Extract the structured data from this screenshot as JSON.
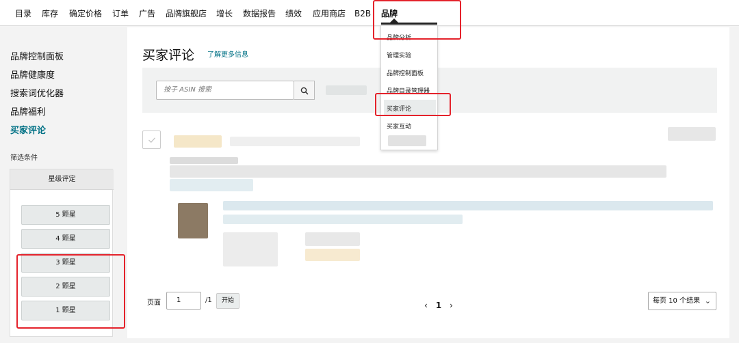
{
  "topnav": {
    "items": [
      "目录",
      "库存",
      "确定价格",
      "订单",
      "广告",
      "品牌旗舰店",
      "增长",
      "数据报告",
      "绩效",
      "应用商店",
      "B2B",
      "品牌"
    ]
  },
  "brand_menu": {
    "items": [
      "品牌分析",
      "管理实验",
      "品牌控制面板",
      "品牌目录管理器",
      "买家评论",
      "买家互动"
    ],
    "active": "买家评论"
  },
  "sidebar": {
    "links": [
      "品牌控制面板",
      "品牌健康度",
      "搜索词优化器",
      "品牌福利",
      "买家评论"
    ],
    "active": "买家评论",
    "filter_title": "筛选条件",
    "filter_panel_title": "星级评定",
    "star_buttons": [
      "5 颗星",
      "4 颗星",
      "3 颗星",
      "2 颗星",
      "1 颗星"
    ]
  },
  "main": {
    "title": "买家评论",
    "learn_more": "了解更多信息",
    "search_placeholder": "按子 ASIN 搜索"
  },
  "pagination": {
    "page_label": "页面",
    "page_value": "1",
    "page_total": "/1",
    "go_label": "开始",
    "prev": "‹",
    "current": "1",
    "next": "›",
    "per_page": "每页 10 个结果"
  },
  "colors": {
    "accent_link": "#007185",
    "highlight_border": "#e4222b"
  }
}
